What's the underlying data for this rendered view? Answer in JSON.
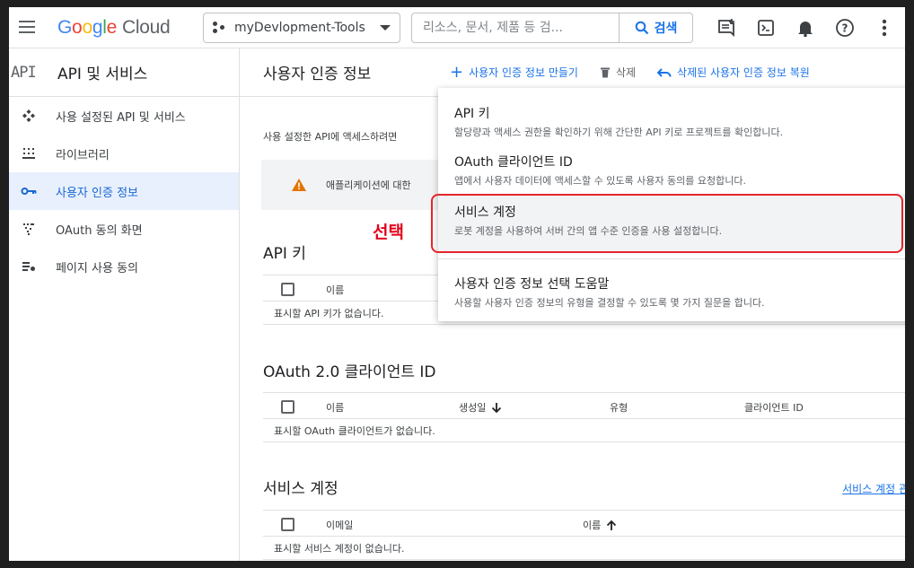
{
  "header": {
    "logo_parts": [
      "G",
      "o",
      "o",
      "g",
      "l",
      "e"
    ],
    "logo_cloud": "Cloud",
    "project_name": "myDevlopment-Tools",
    "search_placeholder": "리소스, 문서, 제품 등 검...",
    "search_button": "검색",
    "icons": [
      "chat-icon",
      "terminal-icon",
      "bell-icon",
      "help-icon",
      "more-vert-icon"
    ]
  },
  "sidebar": {
    "header_icon": "API",
    "title": "API 및 서비스",
    "items": [
      {
        "label": "사용 설정된 API 및 서비스",
        "icon": "api-hub-icon",
        "active": false
      },
      {
        "label": "라이브러리",
        "icon": "library-icon",
        "active": false
      },
      {
        "label": "사용자 인증 정보",
        "icon": "key-icon",
        "active": true
      },
      {
        "label": "OAuth 동의 화면",
        "icon": "consent-icon",
        "active": false
      },
      {
        "label": "페이지 사용 동의",
        "icon": "settings-list-icon",
        "active": false
      }
    ]
  },
  "main": {
    "title": "사용자 인증 정보",
    "toolbar": {
      "create": "사용자 인증 정보 만들기",
      "delete": "삭제",
      "restore": "삭제된 사용자 인증 정보 복원"
    },
    "description": "사용 설정한 API에 액세스하려면",
    "alert_text": "애플리케이션에 대한",
    "annotation": "선택",
    "sections": {
      "api_keys": {
        "title": "API 키",
        "col_name": "이름",
        "empty": "표시할 API 키가 없습니다."
      },
      "oauth": {
        "title": "OAuth 2.0 클라이언트 ID",
        "col_name": "이름",
        "col_created": "생성일",
        "col_type": "유형",
        "col_client_id": "클라이언트 ID",
        "empty": "표시할 OAuth 클라이언트가 없습니다."
      },
      "service_accounts": {
        "title": "서비스 계정",
        "manage_link": "서비스 계정 관",
        "col_email": "이메일",
        "col_name": "이름",
        "empty": "표시할 서비스 계정이 없습니다."
      }
    }
  },
  "dropdown": {
    "items": [
      {
        "title": "API 키",
        "subtitle": "할당량과 액세스 권한을 확인하기 위해 간단한 API 키로 프로젝트를 확인합니다."
      },
      {
        "title": "OAuth 클라이언트 ID",
        "subtitle": "앱에서 사용자 데이터에 액세스할 수 있도록 사용자 동의를 요청합니다."
      },
      {
        "title": "서비스 계정",
        "subtitle": "로봇 계정을 사용하여 서버 간의 앱 수준 인증을 사용 설정합니다."
      },
      {
        "title": "사용자 인증 정보 선택 도움말",
        "subtitle": "사용할 사용자 인증 정보의 유형을 결정할 수 있도록 몇 가지 질문을 합니다."
      }
    ]
  },
  "colors": {
    "accent": "#1a73e8",
    "active_bg": "#e8f0fe",
    "highlight_border": "#e4252b",
    "annotation": "#e3001b"
  }
}
